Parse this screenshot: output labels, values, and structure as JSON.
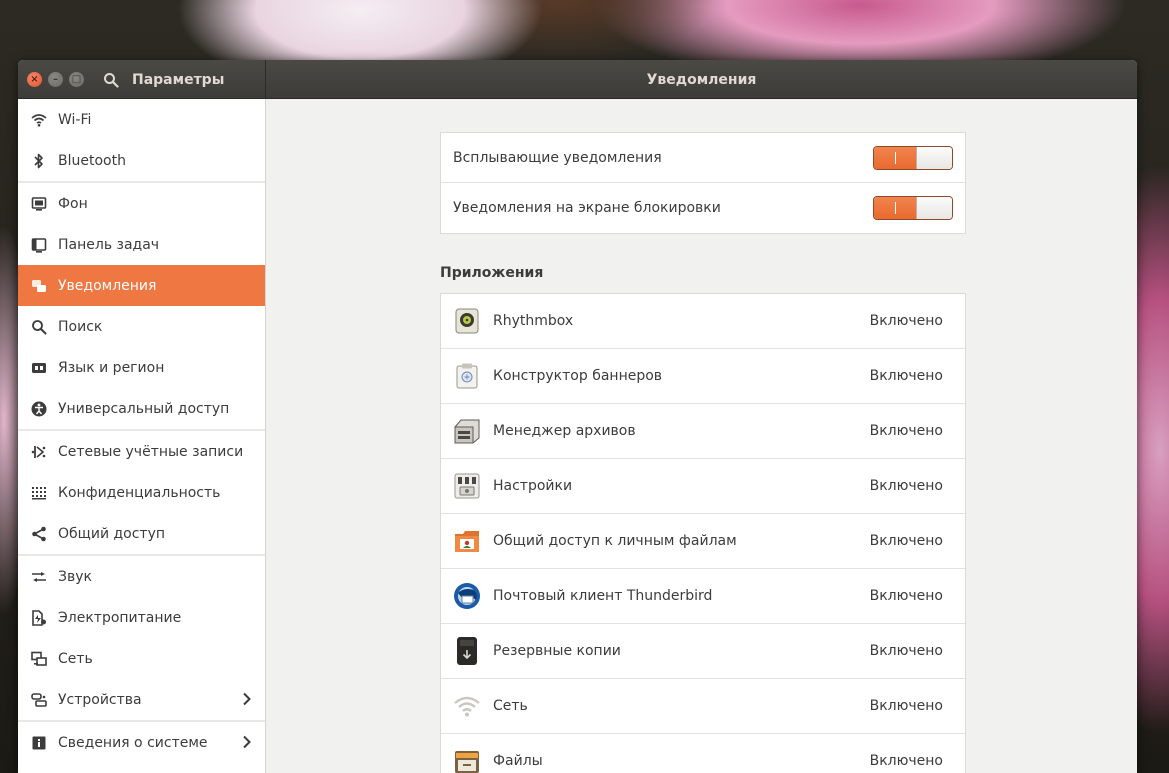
{
  "window": {
    "settings_title": "Параметры",
    "page_title": "Уведомления"
  },
  "sidebar": {
    "items": [
      {
        "label": "Wi-Fi",
        "icon": "wifi-icon"
      },
      {
        "label": "Bluetooth",
        "icon": "bluetooth-icon"
      },
      {
        "label": "Фон",
        "icon": "background-icon"
      },
      {
        "label": "Панель задач",
        "icon": "dock-icon"
      },
      {
        "label": "Уведомления",
        "icon": "notifications-icon",
        "active": true
      },
      {
        "label": "Поиск",
        "icon": "search-icon"
      },
      {
        "label": "Язык и регион",
        "icon": "region-icon"
      },
      {
        "label": "Универсальный доступ",
        "icon": "accessibility-icon"
      },
      {
        "label": "Сетевые учётные записи",
        "icon": "online-accounts-icon"
      },
      {
        "label": "Конфиденциальность",
        "icon": "privacy-icon"
      },
      {
        "label": "Общий доступ",
        "icon": "sharing-icon"
      },
      {
        "label": "Звук",
        "icon": "sound-icon"
      },
      {
        "label": "Электропитание",
        "icon": "power-icon"
      },
      {
        "label": "Сеть",
        "icon": "network-icon"
      },
      {
        "label": "Устройства",
        "icon": "devices-icon"
      },
      {
        "label": "Сведения о системе",
        "icon": "info-icon"
      }
    ]
  },
  "notifications": {
    "popup_label": "Всплывающие уведомления",
    "popup_enabled": true,
    "lockscreen_label": "Уведомления на экране блокировки",
    "lockscreen_enabled": true
  },
  "apps": {
    "section_title": "Приложения",
    "items": [
      {
        "name": "Rhythmbox",
        "status": "Включено",
        "icon": "rhythmbox-icon"
      },
      {
        "name": "Конструктор баннеров",
        "status": "Включено",
        "icon": "banner-designer-icon"
      },
      {
        "name": "Менеджер архивов",
        "status": "Включено",
        "icon": "archive-manager-icon"
      },
      {
        "name": "Настройки",
        "status": "Включено",
        "icon": "settings-app-icon"
      },
      {
        "name": "Общий доступ к личным файлам",
        "status": "Включено",
        "icon": "file-sharing-icon"
      },
      {
        "name": "Почтовый клиент Thunderbird",
        "status": "Включено",
        "icon": "thunderbird-icon"
      },
      {
        "name": "Резервные копии",
        "status": "Включено",
        "icon": "backups-icon"
      },
      {
        "name": "Сеть",
        "status": "Включено",
        "icon": "network-app-icon"
      },
      {
        "name": "Файлы",
        "status": "Включено",
        "icon": "files-icon"
      }
    ]
  },
  "colors": {
    "accent": "#ef7741",
    "titlebar": "#3d3c38",
    "close_button": "#e2532c"
  }
}
